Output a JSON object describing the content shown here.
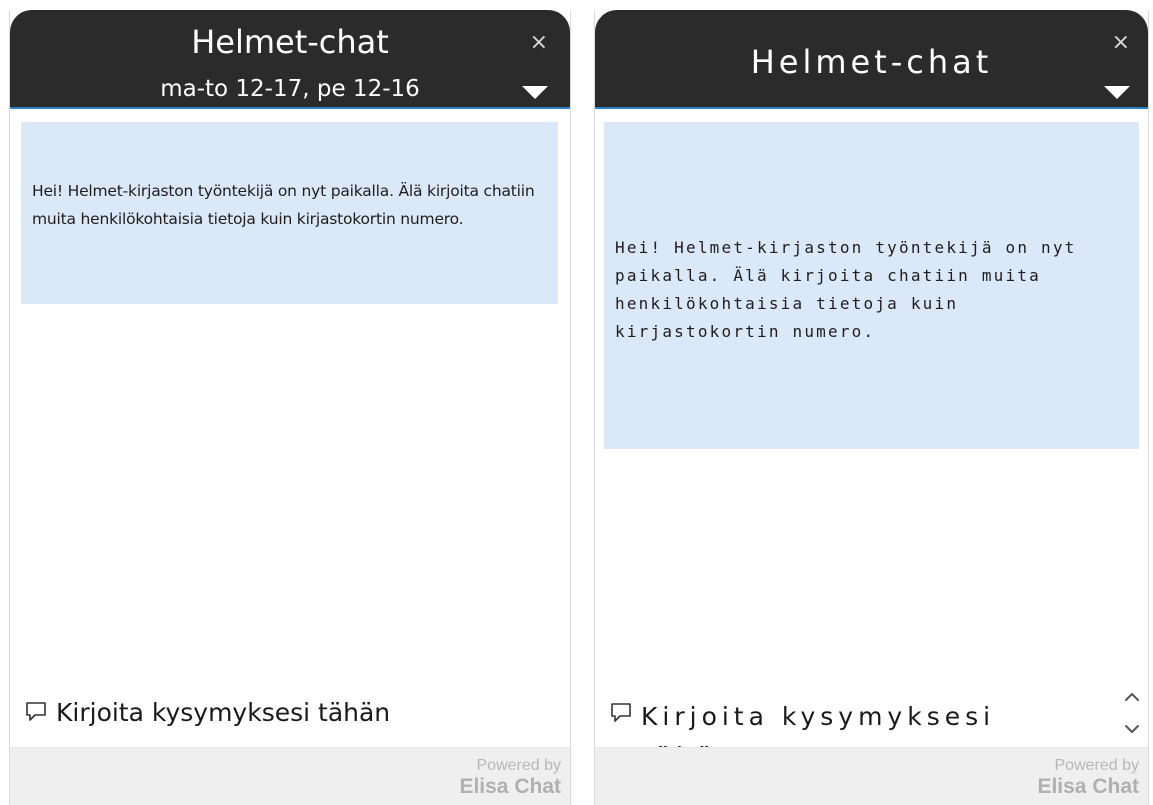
{
  "left_widget": {
    "title": "Helmet-chat",
    "hours": "ma-to 12-17, pe 12-16",
    "close_glyph": "×",
    "message": "Hei! Helmet-kirjaston työntekijä on nyt paikalla. Älä kirjoita chatiin muita henkilökohtaisia tietoja kuin kirjastokortin numero.",
    "input_placeholder": "Kirjoita kysymyksesi tähän",
    "powered_by": "Powered by",
    "brand": "Elisa Chat"
  },
  "right_widget": {
    "title": "Helmet-chat",
    "close_glyph": "×",
    "message": "Hei! Helmet-kirjaston työntekijä on nyt paikalla. Älä kirjoita chatiin muita henkilökohtaisia tietoja kuin kirjastokortin numero.",
    "input_placeholder": "Kirjoita kysymyksesi tähän",
    "powered_by": "Powered by",
    "brand": "Elisa Chat"
  },
  "icons": {
    "close": "close-icon",
    "toggle": "triangle-down-icon",
    "chat": "speech-bubble-icon",
    "scroll_up": "chevron-up-icon",
    "scroll_down": "chevron-down-icon"
  },
  "colors": {
    "header_bg": "#2b2b2b",
    "header_accent": "#2b7fc9",
    "bubble_bg": "#dbe8f8",
    "footer_bg": "#efefef"
  }
}
